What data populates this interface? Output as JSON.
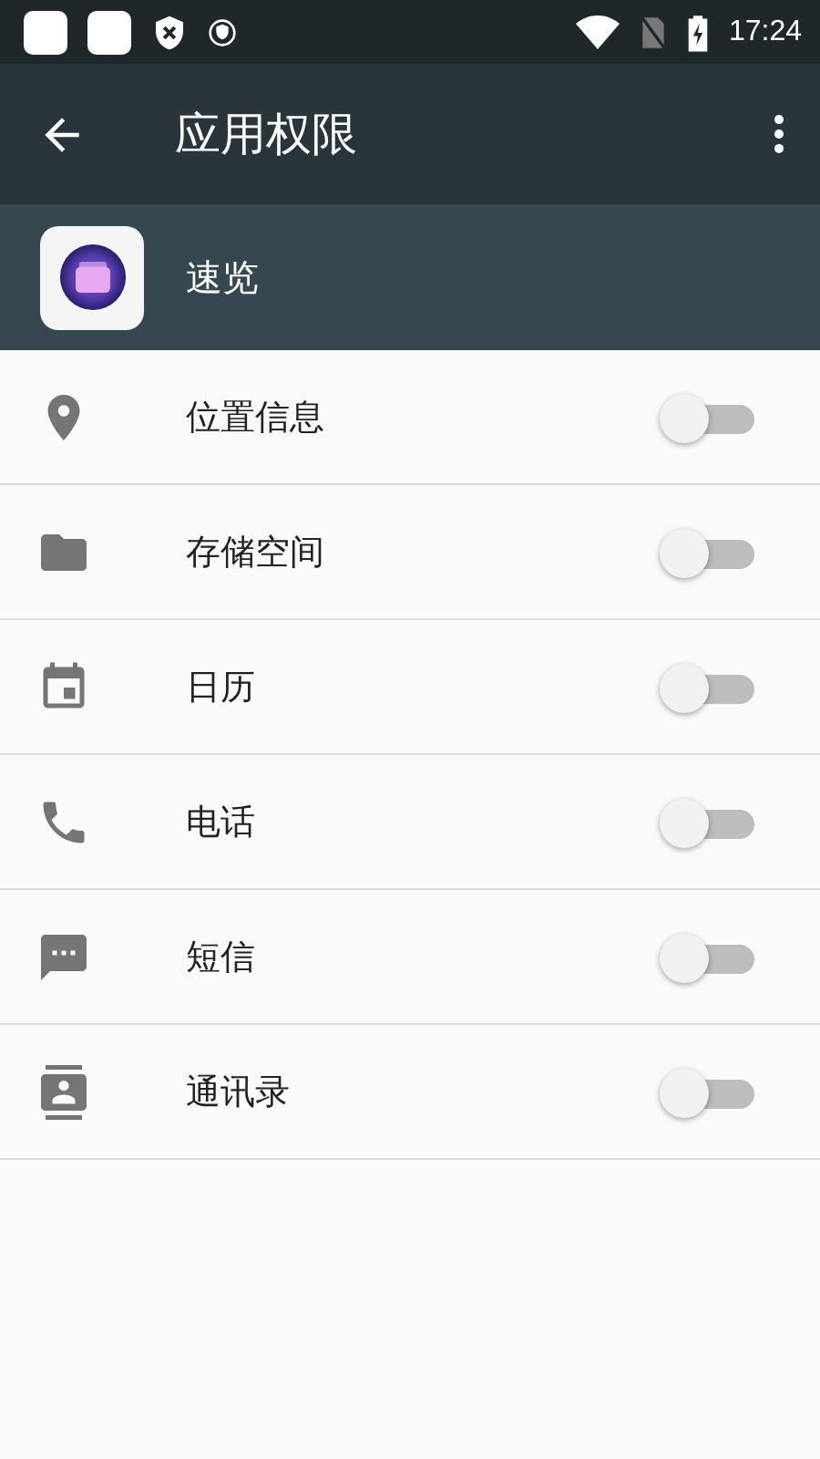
{
  "status_bar": {
    "time": "17:24"
  },
  "app_bar": {
    "title": "应用权限"
  },
  "app_header": {
    "name": "速览"
  },
  "permissions": [
    {
      "label": "位置信息",
      "on": false
    },
    {
      "label": "存储空间",
      "on": false
    },
    {
      "label": "日历",
      "on": false
    },
    {
      "label": "电话",
      "on": false
    },
    {
      "label": "短信",
      "on": false
    },
    {
      "label": "通讯录",
      "on": false
    }
  ]
}
